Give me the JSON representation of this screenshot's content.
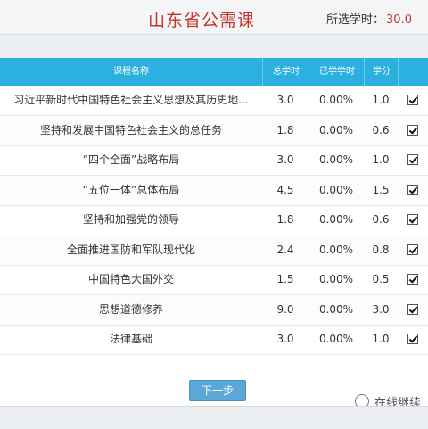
{
  "header": {
    "title": "山东省公需课",
    "selected_label": "所选学时：",
    "selected_value": "30.0",
    "trailing": "所"
  },
  "table": {
    "columns": [
      "课程名称",
      "总学时",
      "已学学时",
      "学分"
    ],
    "rows": [
      {
        "name": "习近平新时代中国特色社会主义思想及其历史地...",
        "total": "3.0",
        "learned": "0.00%",
        "credit": "1.0",
        "checked": true
      },
      {
        "name": "坚持和发展中国特色社会主义的总任务",
        "total": "1.8",
        "learned": "0.00%",
        "credit": "0.6",
        "checked": true
      },
      {
        "name": "“四个全面”战略布局",
        "total": "3.0",
        "learned": "0.00%",
        "credit": "1.0",
        "checked": true
      },
      {
        "name": "“五位一体”总体布局",
        "total": "4.5",
        "learned": "0.00%",
        "credit": "1.5",
        "checked": true
      },
      {
        "name": "坚持和加强党的领导",
        "total": "1.8",
        "learned": "0.00%",
        "credit": "0.6",
        "checked": true
      },
      {
        "name": "全面推进国防和军队现代化",
        "total": "2.4",
        "learned": "0.00%",
        "credit": "0.8",
        "checked": true
      },
      {
        "name": "中国特色大国外交",
        "total": "1.5",
        "learned": "0.00%",
        "credit": "0.5",
        "checked": true
      },
      {
        "name": "思想道德修养",
        "total": "9.0",
        "learned": "0.00%",
        "credit": "3.0",
        "checked": true
      },
      {
        "name": "法律基础",
        "total": "3.0",
        "learned": "0.00%",
        "credit": "1.0",
        "checked": true
      }
    ]
  },
  "next_button": "下一步",
  "watermark": "在线继续",
  "icons": {
    "checkbox": "checkbox-checked-icon",
    "watermark": "wechat-logo-icon"
  },
  "colors": {
    "title": "#c8322c",
    "header_bg": "#2bb0df",
    "button_bg": "#5aa7d8"
  }
}
